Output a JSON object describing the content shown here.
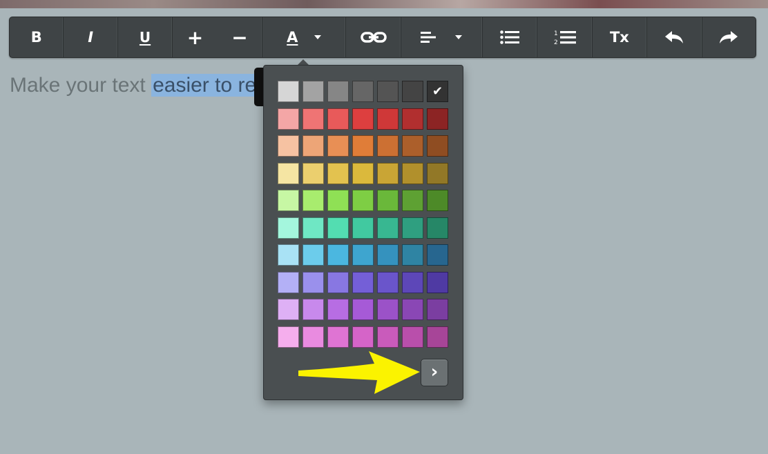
{
  "toolbar": {
    "bold_label": "B",
    "italic_label": "I",
    "underline_label": "U",
    "increase_label": "+",
    "decrease_label": "−",
    "text_color_label": "A",
    "clear_format_label": "Tx"
  },
  "icons": {
    "link": "link-icon",
    "align": "align-left-icon",
    "bullets": "bulleted-list-icon",
    "numbers": "numbered-list-icon",
    "undo": "undo-icon",
    "redo": "redo-icon",
    "next": "chevron-right-icon"
  },
  "editor": {
    "text_before": "Make your text ",
    "text_selected": "easier to rea"
  },
  "color_picker": {
    "selected_index": 6,
    "check_glyph": "✔",
    "next_glyph": "›",
    "swatches": [
      "#d6d6d6",
      "#a3a3a3",
      "#868686",
      "#666666",
      "#545454",
      "#444444",
      "#333333",
      "#f4a6a6",
      "#ef7474",
      "#e85a5a",
      "#dd3f3f",
      "#cf3838",
      "#b12f2f",
      "#8c2424",
      "#f6c2a2",
      "#eda577",
      "#e88f55",
      "#e07d38",
      "#cc7033",
      "#ac5f2b",
      "#8f4d22",
      "#f5e5a3",
      "#ebcf6e",
      "#e3c24f",
      "#dbb93c",
      "#c9a535",
      "#b1902c",
      "#927827",
      "#c7f7a4",
      "#a8ec6e",
      "#8fe055",
      "#7ece44",
      "#6ab83a",
      "#5ea133",
      "#4d8a28",
      "#a4f6dd",
      "#6fe7c4",
      "#53ddb1",
      "#41c9a0",
      "#38b791",
      "#2f9f80",
      "#268767",
      "#a9e2f5",
      "#6ccceb",
      "#4bb7e0",
      "#3ea5cf",
      "#3592be",
      "#2f84a3",
      "#27668f",
      "#b3b0f6",
      "#9a90ec",
      "#8877e2",
      "#745fd7",
      "#6a55cb",
      "#5d47b8",
      "#4f3aa3",
      "#deb0f5",
      "#c889ec",
      "#b76de3",
      "#a65ad7",
      "#9b52c8",
      "#8a47b5",
      "#7b3ea1",
      "#f5aeed",
      "#e98be0",
      "#df74d3",
      "#d564c8",
      "#c95bbb",
      "#b94fab",
      "#a74598"
    ]
  }
}
